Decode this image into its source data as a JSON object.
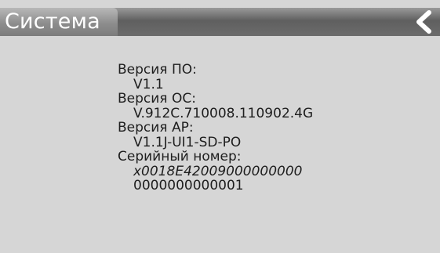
{
  "header": {
    "title": "Система",
    "back_icon": "chevron-left-icon"
  },
  "info": {
    "software_version_label": "Версия ПО:",
    "software_version_value": "V1.1",
    "os_version_label": "Версия ОС:",
    "os_version_value": "V.912C.710008.110902.4G",
    "ap_version_label": "Версия AP:",
    "ap_version_value": "V1.1J-UI1-SD-PO",
    "serial_label": "Серийный номер:",
    "serial_value_line1": "x0018E42009000000000",
    "serial_value_line2": "0000000000001"
  },
  "colors": {
    "background": "#d6d6d6",
    "title_bar": "#6c6c6c",
    "title_text": "#ffffff"
  }
}
